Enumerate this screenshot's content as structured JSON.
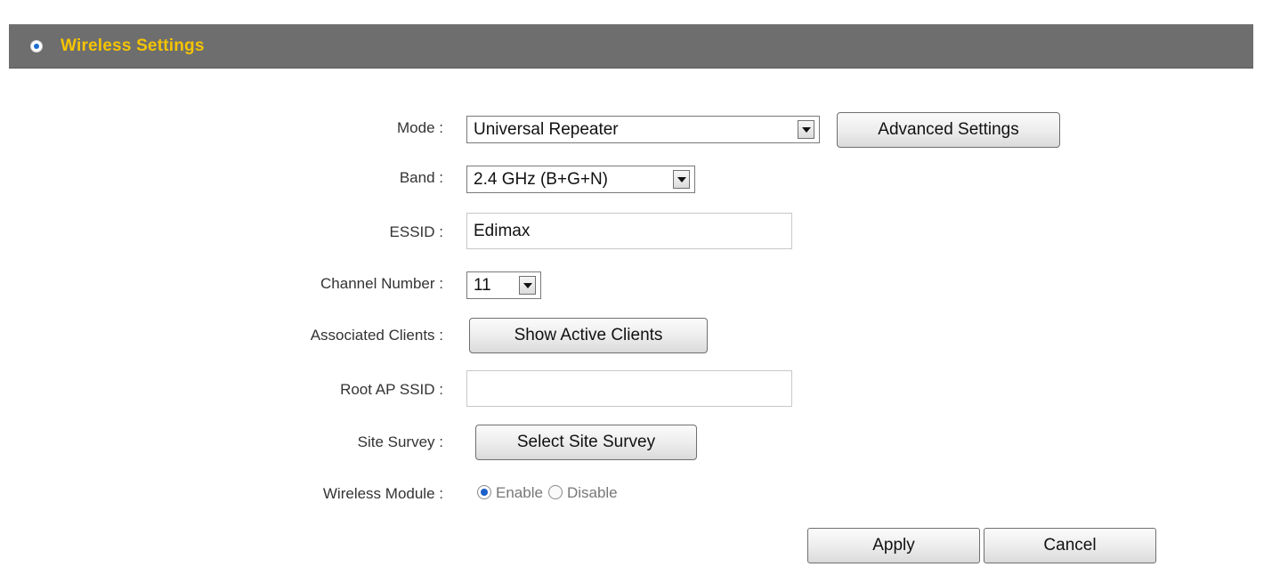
{
  "section": {
    "title": "Wireless Settings",
    "icon": "bullet-icon"
  },
  "form": {
    "mode": {
      "label": "Mode :",
      "value": "Universal Repeater",
      "advanced_button": "Advanced Settings"
    },
    "band": {
      "label": "Band :",
      "value": "2.4 GHz (B+G+N)"
    },
    "essid": {
      "label": "ESSID :",
      "value": "Edimax"
    },
    "channel": {
      "label": "Channel Number :",
      "value": "11"
    },
    "clients": {
      "label": "Associated Clients :",
      "button": "Show Active Clients"
    },
    "root_ap": {
      "label": "Root AP SSID :",
      "value": ""
    },
    "site_survey": {
      "label": "Site Survey :",
      "button": "Select Site Survey"
    },
    "wireless_module": {
      "label": "Wireless Module :",
      "options": [
        "Enable",
        "Disable"
      ],
      "selected": "Enable"
    }
  },
  "actions": {
    "apply": "Apply",
    "cancel": "Cancel"
  },
  "colors": {
    "header_bg": "#6e6e6e",
    "header_text": "#f5c400",
    "accent": "#1b6fd0"
  }
}
